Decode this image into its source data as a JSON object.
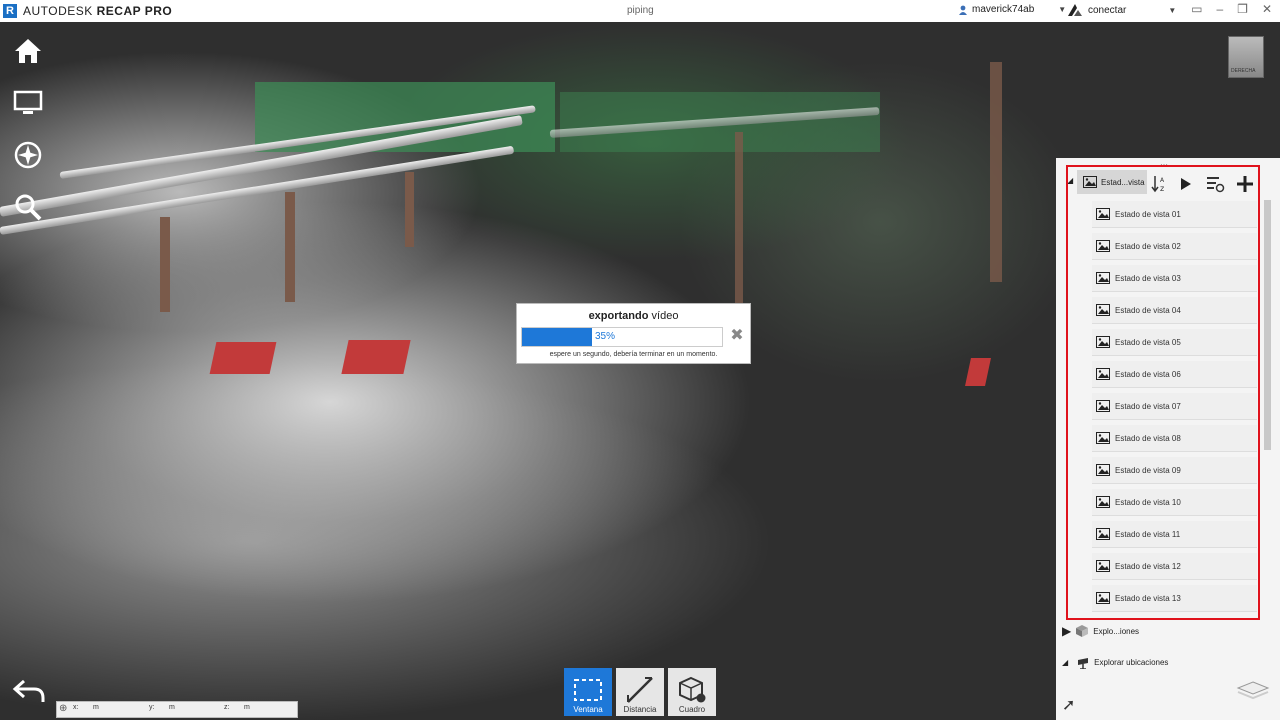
{
  "window": {
    "brand": "AUTODESK",
    "product": "RECAP PRO",
    "project": "piping",
    "user": "maverick74ab",
    "connect": "conectar"
  },
  "dialog": {
    "title_bold": "exportando",
    "title_rest": " vídeo",
    "progress_percent": 35,
    "progress_label": "35%",
    "message": "espere un segundo, debería terminar en un momento."
  },
  "panel": {
    "view_states_header": "Estad...vista",
    "view_states": [
      "Estado de vista 01",
      "Estado de vista 02",
      "Estado de vista 03",
      "Estado de vista 04",
      "Estado de vista 05",
      "Estado de vista 06",
      "Estado de vista 07",
      "Estado de vista 08",
      "Estado de vista 09",
      "Estado de vista 10",
      "Estado de vista 11",
      "Estado de vista 12",
      "Estado de vista 13"
    ],
    "section_explore": "Explo...iones",
    "section_locations": "Explorar ubicaciones"
  },
  "viewcube": {
    "face": "DERECHA"
  },
  "coords": {
    "x_label": "x:",
    "x_unit": "m",
    "y_label": "y:",
    "y_unit": "m",
    "z_label": "z:",
    "z_unit": "m"
  },
  "nav_tools": [
    "Ventana",
    "Distancia",
    "Cuadro"
  ],
  "colors": {
    "accent": "#1e78d8",
    "highlight_border": "#e0121c",
    "active_tool_bg": "#1e78d8"
  }
}
